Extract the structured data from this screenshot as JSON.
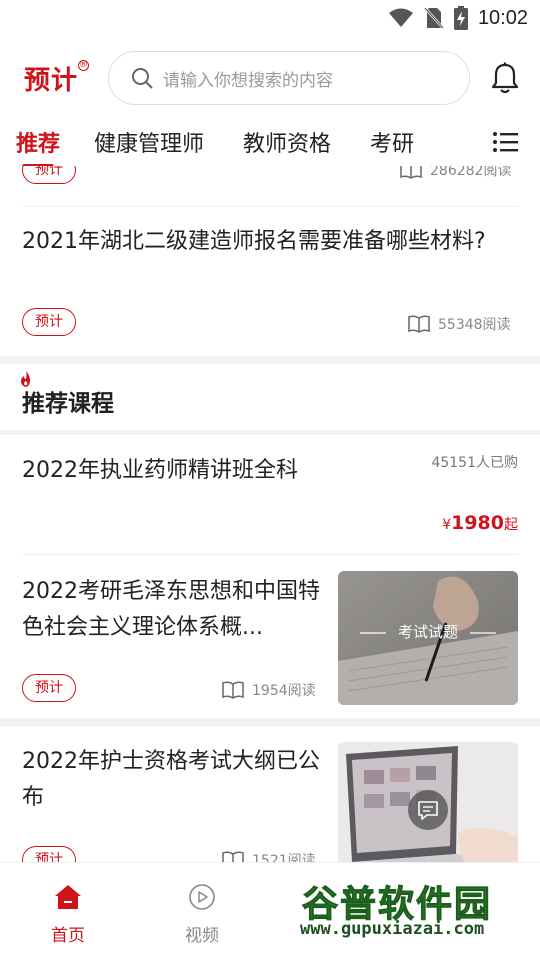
{
  "status_bar": {
    "time": "10:02"
  },
  "header": {
    "logo_text": "预计",
    "logo_reg": "®",
    "search_placeholder": "请输入你想搜索的内容"
  },
  "tabs": [
    {
      "label": "推荐",
      "active": true
    },
    {
      "label": "健康管理师",
      "active": false
    },
    {
      "label": "教师资格",
      "active": false
    },
    {
      "label": "考研",
      "active": false
    }
  ],
  "feed": {
    "partial_item": {
      "tag": "预计",
      "reads": "286282阅读"
    },
    "article_1": {
      "title": "2021年湖北二级建造师报名需要准备哪些材料?",
      "tag": "预计",
      "reads": "55348阅读"
    }
  },
  "recommended_courses": {
    "title": "推荐课程",
    "course": {
      "title": "2022年执业药师精讲班全科",
      "buyers": "45151人已购",
      "price_symbol": "¥",
      "price_amount": "1980",
      "price_suffix": "起"
    }
  },
  "articles": [
    {
      "title": "2022考研毛泽东思想和中国特色社会主义理论体系概...",
      "tag": "预计",
      "reads": "1954阅读",
      "thumb_label": "考试试题"
    },
    {
      "title": "2022年护士资格考试大纲已公布",
      "tag": "预计",
      "reads": "1521阅读"
    }
  ],
  "bottom_nav": [
    {
      "label": "首页",
      "icon": "home-icon",
      "active": true
    },
    {
      "label": "视频",
      "icon": "play-icon",
      "active": false
    }
  ],
  "watermark": {
    "main": "谷普软件园",
    "url": "www.gupuxiazai.com"
  },
  "colors": {
    "brand": "#d0121b",
    "watermark": "#2f8a2f"
  }
}
